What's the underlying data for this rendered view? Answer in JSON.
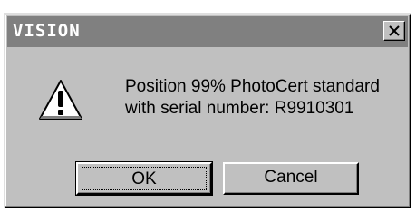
{
  "window": {
    "title": "VISION",
    "close_icon": "close-icon"
  },
  "message": {
    "icon": "warning-icon",
    "line1": "Position 99% PhotoCert standard",
    "line2": "with serial number: R9910301"
  },
  "buttons": {
    "ok_label": "OK",
    "cancel_label": "Cancel"
  },
  "colors": {
    "titlebar": "#808080",
    "face": "#c0c0c0"
  }
}
